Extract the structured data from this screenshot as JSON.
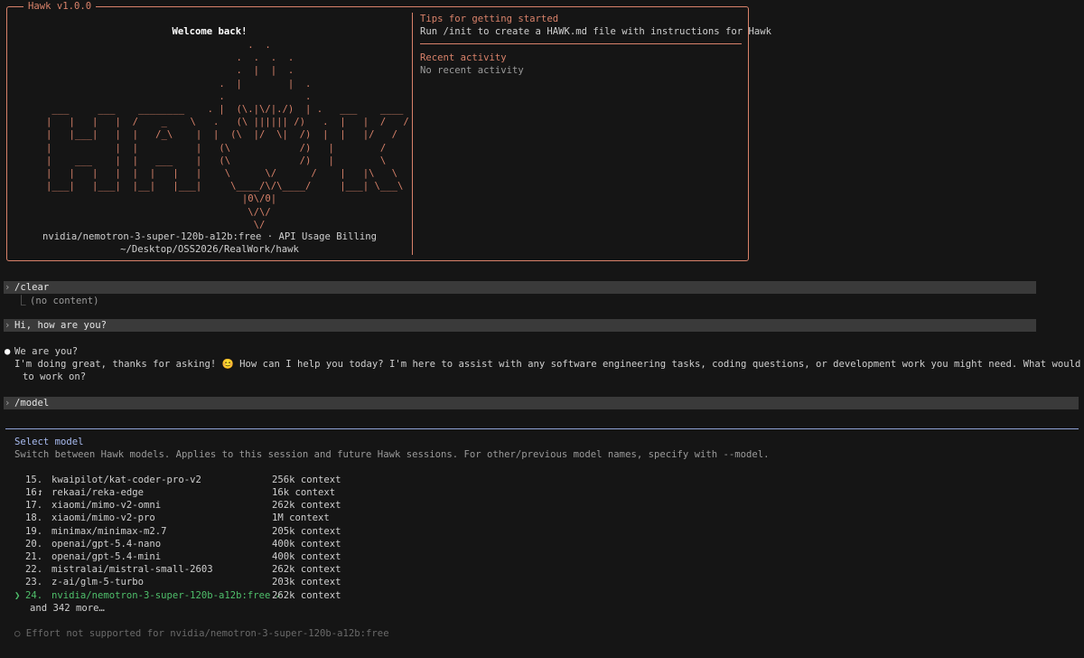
{
  "header_box": {
    "title": "Hawk v1.0.0",
    "welcome": "Welcome back!",
    "model_line": "nvidia/nemotron-3-super-120b-a12b:free · API Usage Billing",
    "path": "~/Desktop/OSS2026/RealWork/hawk",
    "tips_title": "Tips for getting started",
    "tips_text": "Run /init to create a HAWK.md file with instructions for Hawk",
    "recent_title": "Recent activity",
    "recent_text": "No recent activity"
  },
  "transcript": {
    "clear_cmd": "/clear",
    "clear_output": "(no content)",
    "user_msg": "Hi, how are you?",
    "assistant_heading": "We are you?",
    "assistant_line1": "I'm doing great, thanks for asking! 😊 How can I help you today? I'm here to assist with any software engineering tasks, coding questions, or development work you might need. What would you like",
    "assistant_line2": "to work on?",
    "model_cmd": "/model"
  },
  "model_picker": {
    "title": "Select model",
    "subtitle": "Switch between Hawk models. Applies to this session and future Hawk sessions. For other/previous model names, specify with --model.",
    "items": [
      {
        "prefix": "↑",
        "num": "15.",
        "name": "kwaipilot/kat-coder-pro-v2",
        "ctx": "256k context"
      },
      {
        "prefix": "",
        "num": "16.",
        "name": "rekaai/reka-edge",
        "ctx": "16k context"
      },
      {
        "prefix": "",
        "num": "17.",
        "name": "xiaomi/mimo-v2-omni",
        "ctx": "262k context"
      },
      {
        "prefix": "",
        "num": "18.",
        "name": "xiaomi/mimo-v2-pro",
        "ctx": "1M context"
      },
      {
        "prefix": "",
        "num": "19.",
        "name": "minimax/minimax-m2.7",
        "ctx": "205k context"
      },
      {
        "prefix": "",
        "num": "20.",
        "name": "openai/gpt-5.4-nano",
        "ctx": "400k context"
      },
      {
        "prefix": "",
        "num": "21.",
        "name": "openai/gpt-5.4-mini",
        "ctx": "400k context"
      },
      {
        "prefix": "",
        "num": "22.",
        "name": "mistralai/mistral-small-2603",
        "ctx": "262k context"
      },
      {
        "prefix": "",
        "num": "23.",
        "name": "z-ai/glm-5-turbo",
        "ctx": "203k context"
      },
      {
        "prefix": "❯",
        "num": "24.",
        "name": "nvidia/nemotron-3-super-120b-a12b:free ✓",
        "ctx": "262k context"
      }
    ],
    "more": "and 342 more…",
    "effort_note": "○ Effort not supported for nvidia/nemotron-3-super-120b-a12b:free"
  },
  "colors": {
    "accent": "#d9826a",
    "selected": "#4fbf6b",
    "picker_title": "#a8bbf0"
  }
}
